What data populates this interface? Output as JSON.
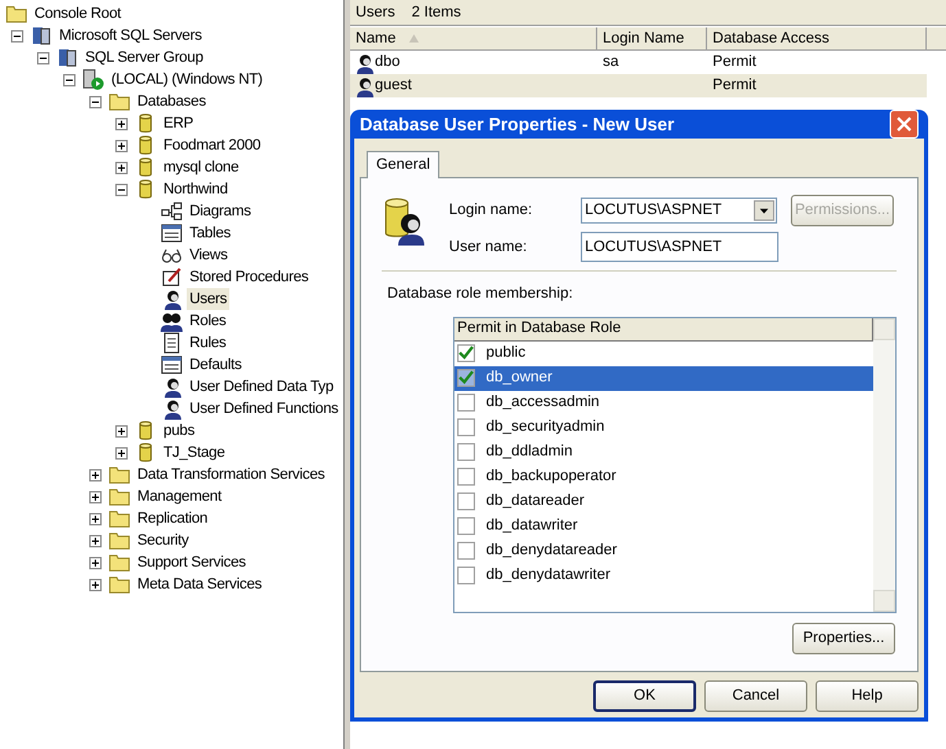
{
  "tree": {
    "items": [
      {
        "label": "Console Root",
        "kind": "folder",
        "selected": false,
        "children": [
          {
            "label": "Microsoft SQL Servers",
            "kind": "servers",
            "expanded": true,
            "selected": false,
            "children": [
              {
                "label": "SQL Server Group",
                "kind": "servers",
                "expanded": true,
                "selected": false,
                "children": [
                  {
                    "label": "(LOCAL) (Windows NT)",
                    "kind": "server",
                    "expanded": true,
                    "selected": false,
                    "children": [
                      {
                        "label": "Databases",
                        "kind": "folder",
                        "expanded": true,
                        "selected": false,
                        "children": [
                          {
                            "label": "ERP",
                            "kind": "database",
                            "expanded": false,
                            "selected": false
                          },
                          {
                            "label": "Foodmart 2000",
                            "kind": "database",
                            "expanded": false,
                            "selected": false
                          },
                          {
                            "label": "mysql clone",
                            "kind": "database",
                            "expanded": false,
                            "selected": false
                          },
                          {
                            "label": "Northwind",
                            "kind": "database",
                            "expanded": true,
                            "selected": false,
                            "children": [
                              {
                                "label": "Diagrams",
                                "kind": "diagram",
                                "selected": false
                              },
                              {
                                "label": "Tables",
                                "kind": "table",
                                "selected": false
                              },
                              {
                                "label": "Views",
                                "kind": "view",
                                "selected": false
                              },
                              {
                                "label": "Stored Procedures",
                                "kind": "script",
                                "selected": false
                              },
                              {
                                "label": "Users",
                                "kind": "person",
                                "selected": true
                              },
                              {
                                "label": "Roles",
                                "kind": "people",
                                "selected": false
                              },
                              {
                                "label": "Rules",
                                "kind": "document",
                                "selected": false
                              },
                              {
                                "label": "Defaults",
                                "kind": "table",
                                "selected": false
                              },
                              {
                                "label": "User Defined Data Typ",
                                "kind": "person",
                                "selected": false
                              },
                              {
                                "label": "User Defined Functions",
                                "kind": "person",
                                "selected": false
                              }
                            ]
                          },
                          {
                            "label": "pubs",
                            "kind": "database",
                            "expanded": false,
                            "selected": false
                          },
                          {
                            "label": "TJ_Stage",
                            "kind": "database",
                            "expanded": false,
                            "selected": false
                          }
                        ]
                      },
                      {
                        "label": "Data Transformation Services",
                        "kind": "folder",
                        "expanded": false,
                        "selected": false
                      },
                      {
                        "label": "Management",
                        "kind": "folder",
                        "expanded": false,
                        "selected": false
                      },
                      {
                        "label": "Replication",
                        "kind": "folder",
                        "expanded": false,
                        "selected": false
                      },
                      {
                        "label": "Security",
                        "kind": "folder",
                        "expanded": false,
                        "selected": false
                      },
                      {
                        "label": "Support Services",
                        "kind": "folder",
                        "expanded": false,
                        "selected": false
                      },
                      {
                        "label": "Meta Data Services",
                        "kind": "folder",
                        "expanded": false,
                        "selected": false
                      }
                    ]
                  }
                ]
              }
            ]
          }
        ]
      }
    ]
  },
  "pane": {
    "title": "Users",
    "count": "2 Items"
  },
  "list": {
    "columns": [
      "Name",
      "Login Name",
      "Database Access"
    ],
    "rows": [
      {
        "name": "dbo",
        "login": "sa",
        "access": "Permit",
        "selected": false
      },
      {
        "name": "guest",
        "access": "Permit",
        "selected": true
      }
    ]
  },
  "dialog": {
    "title": "Database User Properties - New User",
    "tabs": [
      {
        "label": "General",
        "selected": true
      }
    ],
    "login_name": {
      "label": "Login name:",
      "value": "LOCUTUS\\ASPNET"
    },
    "user_name": {
      "label": "User name:",
      "value": "LOCUTUS\\ASPNET"
    },
    "permissions_button": {
      "label": "Permissions...",
      "disabled": true
    },
    "section_label": "Database role membership:",
    "roles_header": "Permit in Database Role",
    "roles": [
      {
        "label": "public",
        "checked": true,
        "selected": false
      },
      {
        "label": "db_owner",
        "checked": true,
        "selected": true
      },
      {
        "label": "db_accessadmin",
        "checked": false,
        "selected": false
      },
      {
        "label": "db_securityadmin",
        "checked": false,
        "selected": false
      },
      {
        "label": "db_ddladmin",
        "checked": false,
        "selected": false
      },
      {
        "label": "db_backupoperator",
        "checked": false,
        "selected": false
      },
      {
        "label": "db_datareader",
        "checked": false,
        "selected": false
      },
      {
        "label": "db_datawriter",
        "checked": false,
        "selected": false
      },
      {
        "label": "db_denydatareader",
        "checked": false,
        "selected": false
      },
      {
        "label": "db_denydatawriter",
        "checked": false,
        "selected": false
      }
    ],
    "properties_button": "Properties...",
    "buttons": [
      {
        "label": "OK",
        "default": true
      },
      {
        "label": "Cancel",
        "default": false
      },
      {
        "label": "Help",
        "default": false
      }
    ]
  }
}
